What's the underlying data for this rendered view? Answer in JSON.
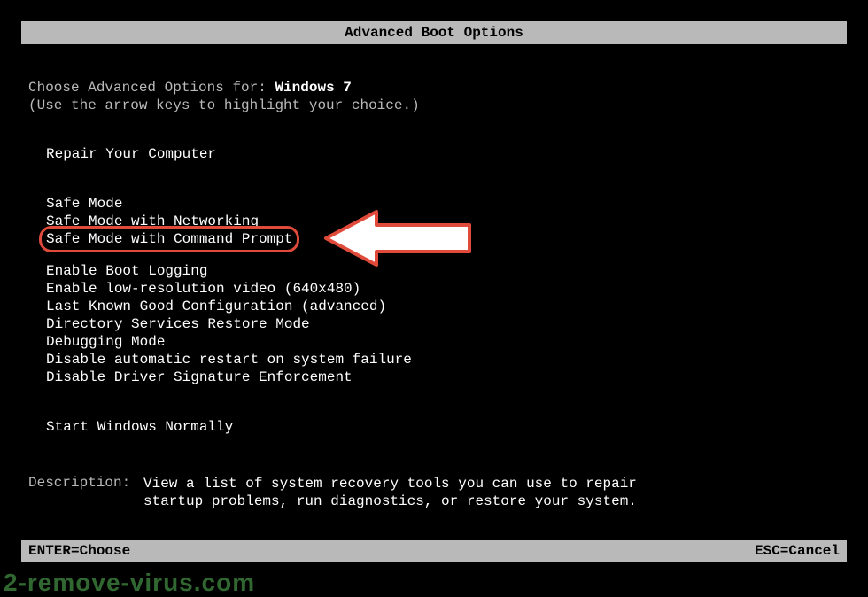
{
  "header": {
    "title": "Advanced Boot Options"
  },
  "prompt": {
    "prefix": "Choose Advanced Options for: ",
    "os": "Windows 7",
    "hint": "(Use the arrow keys to highlight your choice.)"
  },
  "groups": {
    "repair": {
      "items": [
        "Repair Your Computer"
      ]
    },
    "safe": {
      "items": [
        "Safe Mode",
        "Safe Mode with Networking",
        "Safe Mode with Command Prompt"
      ],
      "highlighted_index": 2
    },
    "advanced": {
      "items": [
        "Enable Boot Logging",
        "Enable low-resolution video (640x480)",
        "Last Known Good Configuration (advanced)",
        "Directory Services Restore Mode",
        "Debugging Mode",
        "Disable automatic restart on system failure",
        "Disable Driver Signature Enforcement"
      ]
    },
    "normal": {
      "items": [
        "Start Windows Normally"
      ]
    }
  },
  "description": {
    "label": "Description:",
    "text": "View a list of system recovery tools you can use to repair startup problems, run diagnostics, or restore your system."
  },
  "footer": {
    "left": "ENTER=Choose",
    "right": "ESC=Cancel"
  },
  "watermark": "2-remove-virus.com",
  "annotation": {
    "arrow_icon": "arrow-left-icon"
  }
}
